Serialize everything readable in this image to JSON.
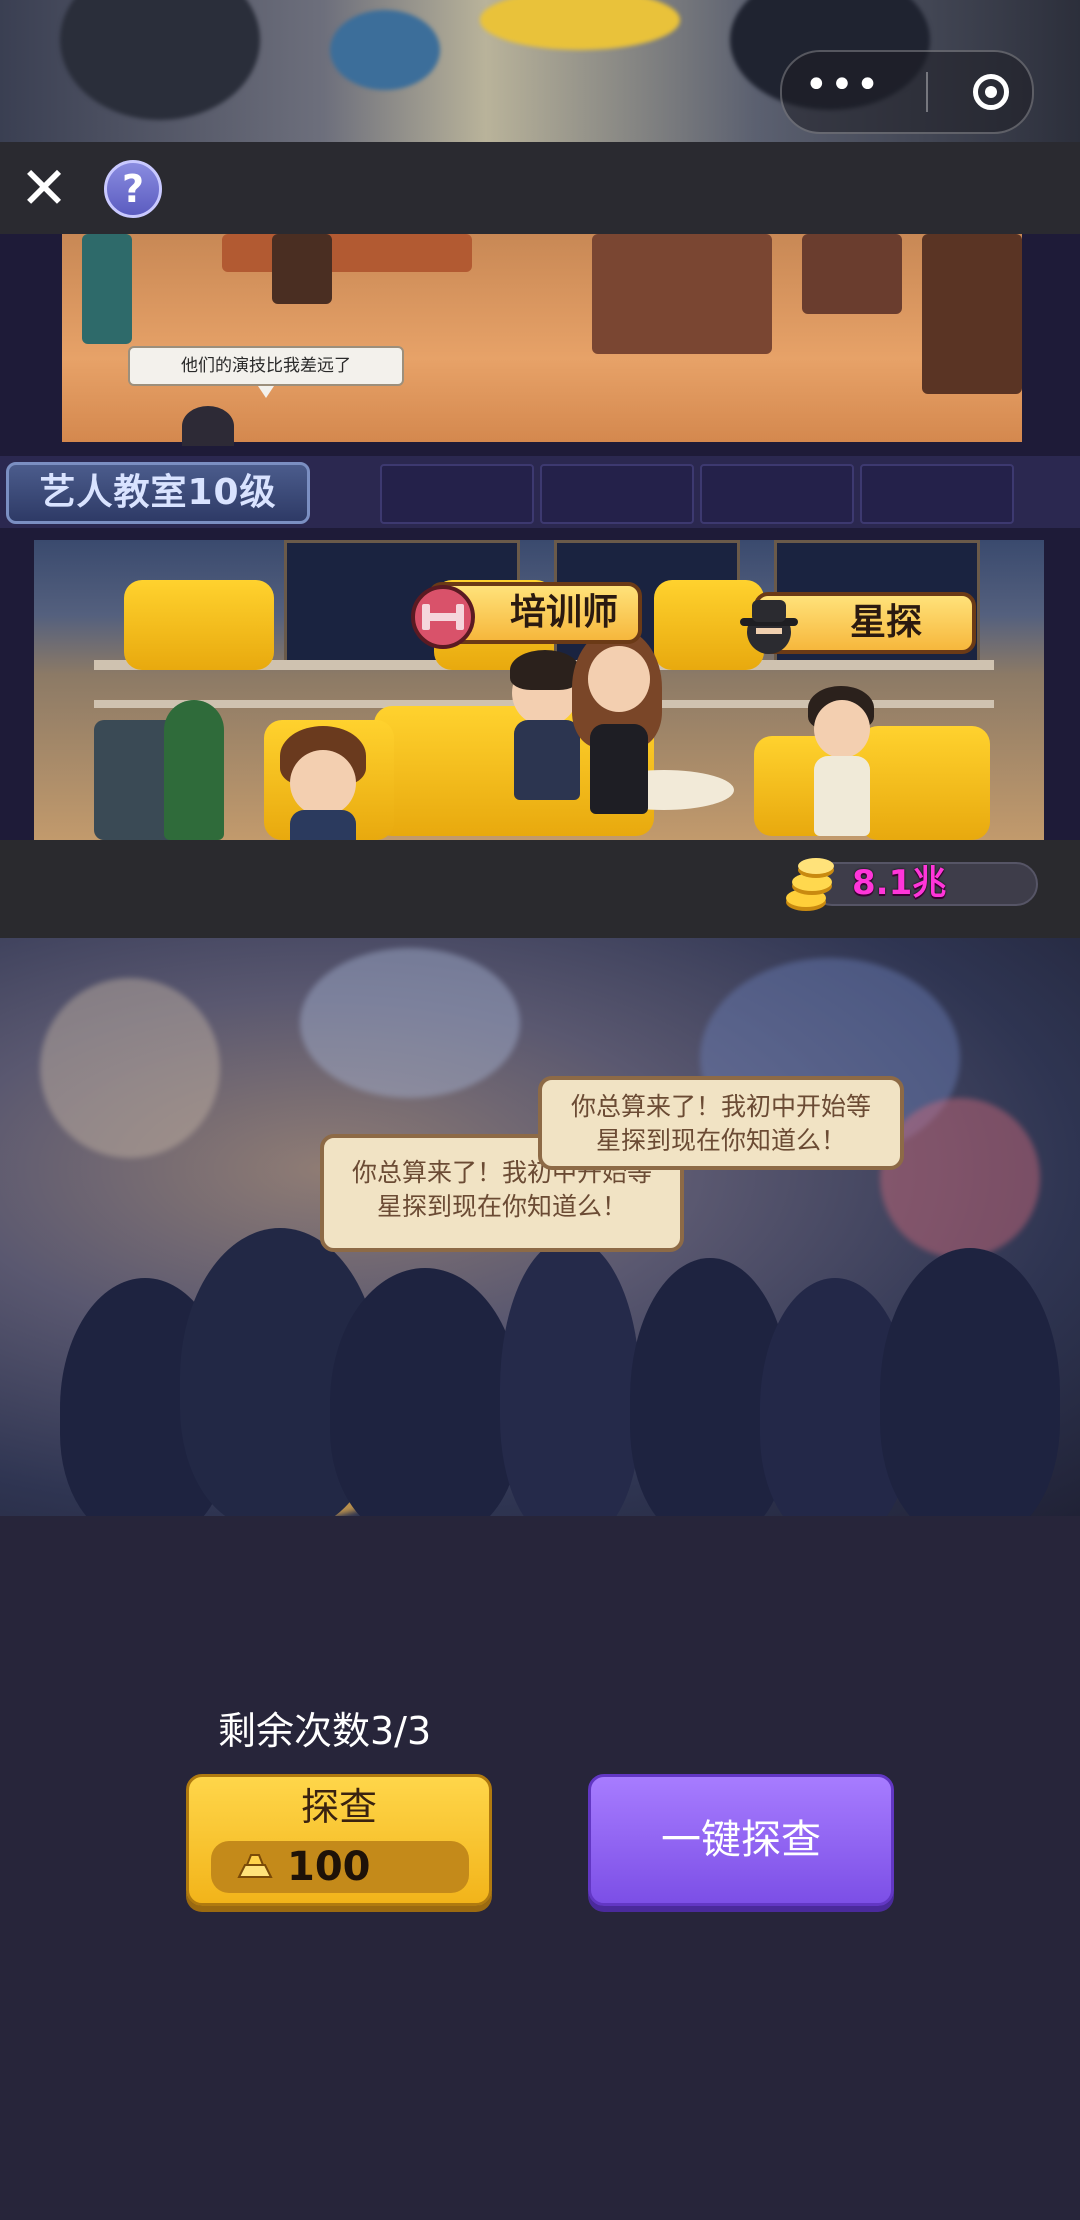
{
  "capsule": {
    "menu_icon": "more-dots-icon",
    "close_icon": "target-circle-icon"
  },
  "toolbar": {
    "close_icon": "close-x-icon",
    "help_label": "?"
  },
  "scene": {
    "upper_room_bubble": "他们的演技比我差远了",
    "room_label": "艺人教室10级",
    "trainer_label": "培训师",
    "scout_label": "星探"
  },
  "coins": {
    "value": "8.1兆",
    "icon": "gold-coin-stack-icon"
  },
  "event": {
    "speech_front": "你总算来了！我初中开始等星探到现在你知道么！",
    "speech_back": "你总算来了！我初中开始等星探到现在你知道么！"
  },
  "actions": {
    "remaining_text": "剩余次数3/3",
    "probe_label": "探查",
    "probe_cost": "100",
    "probe_cost_icon": "gold-ingot-icon",
    "oneclick_label": "一键探查"
  },
  "colors": {
    "coin_text": "#ff35d9",
    "probe_button": "#f2b41a",
    "oneclick_button": "#7c4fe6",
    "background": "#27253a"
  }
}
